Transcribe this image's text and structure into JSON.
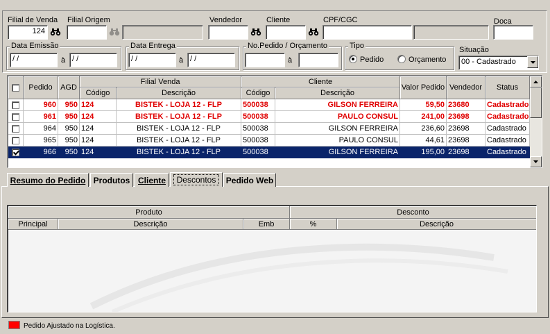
{
  "filters": {
    "filial_venda": {
      "label": "Filial de Venda",
      "value": "124"
    },
    "filial_origem": {
      "label": "Filial Origem",
      "value": "",
      "desc": ""
    },
    "vendedor": {
      "label": "Vendedor",
      "value": ""
    },
    "cliente": {
      "label": "Cliente",
      "value": ""
    },
    "cpf_cgc": {
      "label": "CPF/CGC",
      "value": "",
      "desc": ""
    },
    "doca": {
      "label": "Doca",
      "value": ""
    },
    "data_emissao": {
      "label": "Data Emissão",
      "from": " / /",
      "sep": "à",
      "to": " / /"
    },
    "data_entrega": {
      "label": "Data Entrega",
      "from": " / /",
      "sep": "à",
      "to": " / /"
    },
    "no_pedido": {
      "label": "No.Pedido / Orçamento",
      "from": "",
      "sep": "à",
      "to": ""
    },
    "tipo": {
      "label": "Tipo",
      "options": [
        "Pedido",
        "Orçamento"
      ],
      "selected": "Pedido"
    },
    "situacao": {
      "label": "Situação",
      "value": "00 - Cadastrado"
    }
  },
  "grid": {
    "headers": {
      "pedido": "Pedido",
      "agd": "AGD",
      "filial_venda": "Filial Venda",
      "codigo": "Código",
      "descricao": "Descrição",
      "cliente": "Cliente",
      "codigo2": "Código",
      "descricao2": "Descrição",
      "valor_pedido": "Valor Pedido",
      "vendedor": "Vendedor",
      "status": "Status"
    },
    "rows": [
      {
        "checked": false,
        "pedido": "960",
        "agd": "950",
        "filial": "124",
        "filial_desc": "BISTEK - LOJA 12 - FLP",
        "cli_cod": "500038",
        "cli_desc": "GILSON FERREIRA",
        "valor": "59,50",
        "vendedor": "23680",
        "status": "Cadastrado",
        "style": "red"
      },
      {
        "checked": false,
        "pedido": "961",
        "agd": "950",
        "filial": "124",
        "filial_desc": "BISTEK - LOJA 12 - FLP",
        "cli_cod": "500038",
        "cli_desc": "PAULO CONSUL",
        "valor": "241,00",
        "vendedor": "23698",
        "status": "Cadastrado",
        "style": "red"
      },
      {
        "checked": false,
        "pedido": "964",
        "agd": "950",
        "filial": "124",
        "filial_desc": "BISTEK - LOJA 12 - FLP",
        "cli_cod": "500038",
        "cli_desc": "GILSON FERREIRA",
        "valor": "236,60",
        "vendedor": "23698",
        "status": "Cadastrado",
        "style": "normal"
      },
      {
        "checked": false,
        "pedido": "965",
        "agd": "950",
        "filial": "124",
        "filial_desc": "BISTEK - LOJA 12 - FLP",
        "cli_cod": "500038",
        "cli_desc": "PAULO CONSUL",
        "valor": "44,61",
        "vendedor": "23698",
        "status": "Cadastrado",
        "style": "normal"
      },
      {
        "checked": true,
        "pedido": "966",
        "agd": "950",
        "filial": "124",
        "filial_desc": "BISTEK - LOJA 12 - FLP",
        "cli_cod": "500038",
        "cli_desc": "GILSON FERREIRA",
        "valor": "195,00",
        "vendedor": "23698",
        "status": "Cadastrado",
        "style": "selected"
      }
    ]
  },
  "tabs": [
    {
      "label": "Resumo do Pedido",
      "active": false
    },
    {
      "label": "Produtos",
      "active": false
    },
    {
      "label": "Cliente",
      "active": false
    },
    {
      "label": "Descontos",
      "active": true
    },
    {
      "label": "Pedido Web",
      "active": false
    }
  ],
  "descontos_grid": {
    "group_produto": "Produto",
    "group_desconto": "Desconto",
    "cols": {
      "principal": "Principal",
      "descricao": "Descrição",
      "emb": "Emb",
      "pct": "%",
      "desc_descricao": "Descrição"
    }
  },
  "legend": {
    "text": "Pedido Ajustado na Logística.",
    "color": "#ff0000"
  },
  "colors": {
    "selection": "#0a246a",
    "adjusted_text": "#e00000",
    "face": "#d4d0c8"
  }
}
